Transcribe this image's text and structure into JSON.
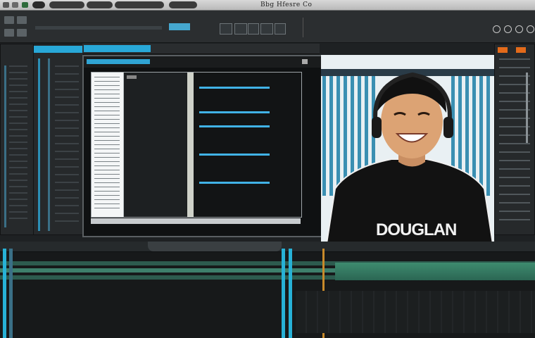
{
  "window": {
    "title": "Bbg Hfesre Co"
  },
  "webcam": {
    "shirt_text": "DOUGLAN"
  },
  "colors": {
    "accent": "#27b1d6",
    "panel_bg": "#26292b",
    "shirt": "#121212"
  }
}
